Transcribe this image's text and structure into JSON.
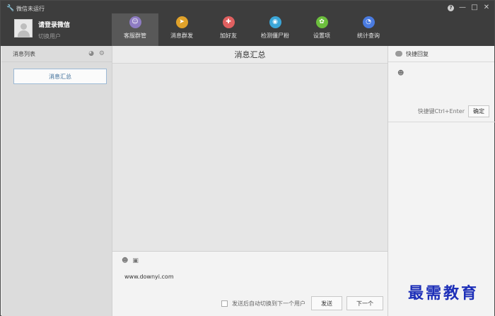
{
  "titlebar": {
    "title": "微信未运行"
  },
  "window_controls": {
    "help": "?",
    "minimize": "—",
    "maximize": "□",
    "close": "✕"
  },
  "user": {
    "name": "请登录微信",
    "switch": "切换用户"
  },
  "nav": [
    {
      "label": "客服群管",
      "color": "#8e7cc3",
      "glyph": "☺",
      "icon": "customer-service-icon"
    },
    {
      "label": "消息群发",
      "color": "#e0a22a",
      "glyph": "➤",
      "icon": "send-icon"
    },
    {
      "label": "加好友",
      "color": "#e06060",
      "glyph": "✚",
      "icon": "add-friend-icon"
    },
    {
      "label": "检测僵尸粉",
      "color": "#3ba6d8",
      "glyph": "◉",
      "icon": "detect-icon"
    },
    {
      "label": "设置项",
      "color": "#6cbf3d",
      "glyph": "✿",
      "icon": "settings-icon"
    },
    {
      "label": "统计查询",
      "color": "#4a7be0",
      "glyph": "◔",
      "icon": "stats-icon"
    }
  ],
  "left": {
    "header": "消息列表",
    "summary_button": "消息汇总"
  },
  "middle": {
    "title": "消息汇总",
    "compose_text": "www.downyi.com",
    "auto_switch_label": "发送后自动切换到下一个用户",
    "send_button": "发送",
    "next_button": "下一个"
  },
  "right": {
    "header": "快捷回复",
    "shortcut_label": "快捷键Ctrl+Enter",
    "confirm_button": "确定"
  },
  "watermark": "最需教育"
}
